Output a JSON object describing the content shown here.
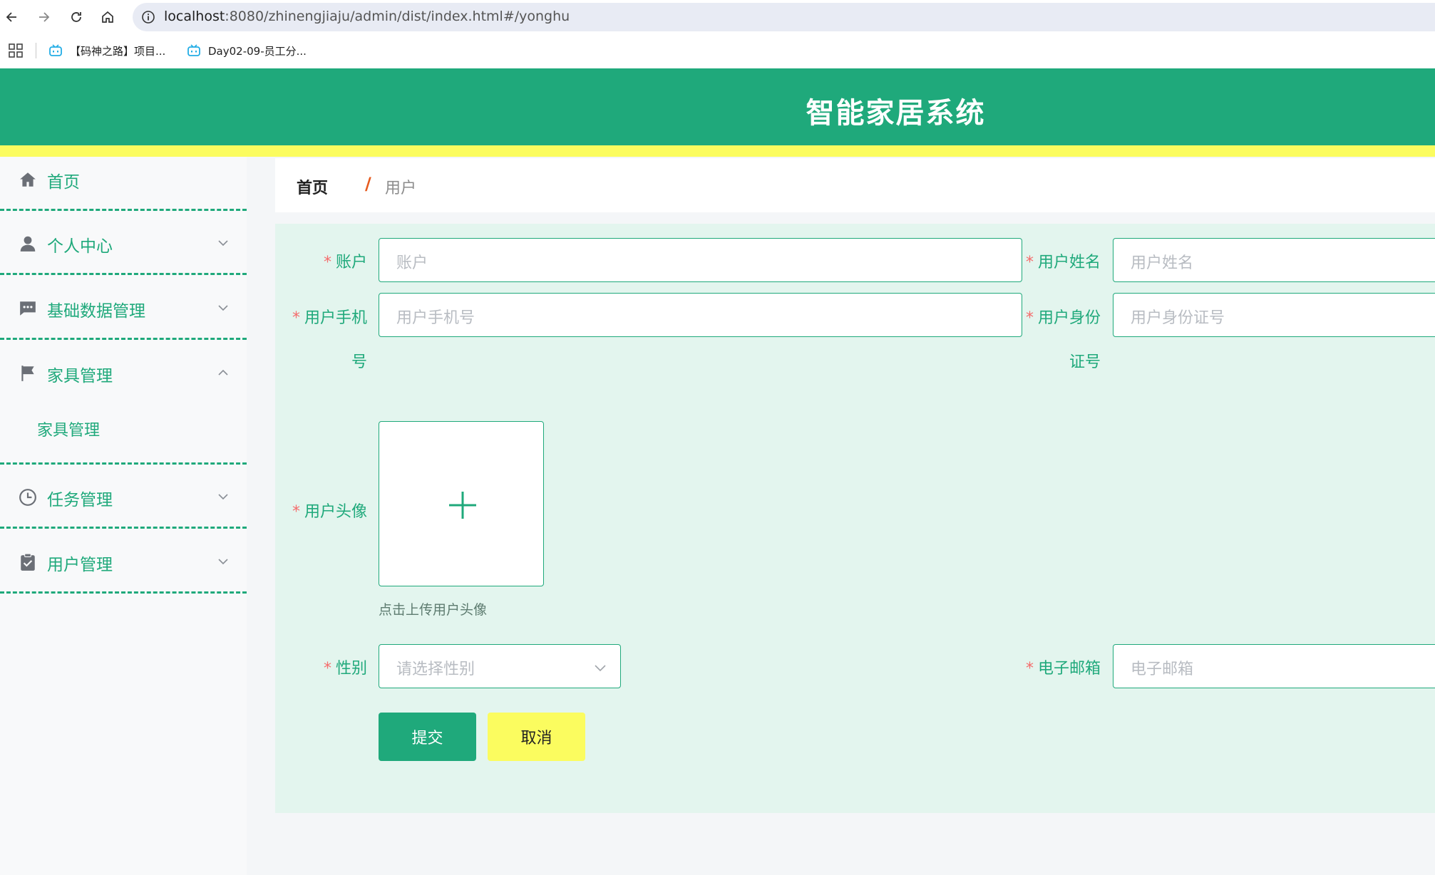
{
  "browser": {
    "url_host": "localhost",
    "url_rest": ":8080/zhinengjiaju/admin/dist/index.html#/yonghu",
    "bookmarks": [
      {
        "label": "【码神之路】项目..."
      },
      {
        "label": "Day02-09-员工分..."
      }
    ]
  },
  "app": {
    "title": "智能家居系统",
    "colors": {
      "primary": "#1fa97b",
      "accent_yellow": "#fbfc5f",
      "form_bg": "#e3f5ee",
      "required": "#f56c6c"
    }
  },
  "sidebar": {
    "items": [
      {
        "label": "首页",
        "icon": "home-icon"
      },
      {
        "label": "个人中心",
        "icon": "user-icon",
        "expanded": false
      },
      {
        "label": "基础数据管理",
        "icon": "message-icon",
        "expanded": false
      },
      {
        "label": "家具管理",
        "icon": "flag-icon",
        "expanded": true,
        "children": [
          {
            "label": "家具管理"
          }
        ]
      },
      {
        "label": "任务管理",
        "icon": "clock-icon",
        "expanded": false
      },
      {
        "label": "用户管理",
        "icon": "clipboard-icon",
        "expanded": false
      }
    ]
  },
  "breadcrumb": {
    "home": "首页",
    "separator": "/",
    "current": "用户"
  },
  "form": {
    "account": {
      "label": "账户",
      "placeholder": "账户"
    },
    "name": {
      "label": "用户姓名",
      "placeholder": "用户姓名"
    },
    "phone": {
      "label_line1": "用户手机",
      "label_line2": "号",
      "placeholder": "用户手机号"
    },
    "idcard": {
      "label_line1": "用户身份",
      "label_line2": "证号",
      "placeholder": "用户身份证号"
    },
    "avatar": {
      "label": "用户头像",
      "tip": "点击上传用户头像"
    },
    "gender": {
      "label": "性别",
      "placeholder": "请选择性别"
    },
    "email": {
      "label": "电子邮箱",
      "placeholder": "电子邮箱"
    },
    "required_mark": "*",
    "submit_label": "提交",
    "cancel_label": "取消"
  }
}
